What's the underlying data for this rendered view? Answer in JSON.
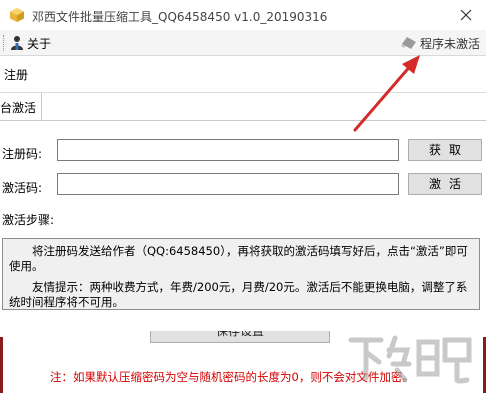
{
  "window": {
    "title": "邓西文件批量压缩工具_QQ6458450 v1.0_20190316",
    "close_icon": "close-icon",
    "app_icon": "app-box-icon"
  },
  "toolbar": {
    "about_label": "关于",
    "about_icon": "user-icon",
    "status_label": "程序未激活",
    "status_icon": "eraser-icon"
  },
  "outer_tabs": [
    {
      "label": "注册"
    }
  ],
  "inner_tabs": [
    {
      "label": "台激活"
    }
  ],
  "form": {
    "register_code_label": "注册码:",
    "register_code_value": "",
    "get_button": "获取",
    "activation_code_label": "激活码:",
    "activation_code_value": "",
    "activate_button": "激活",
    "steps_label": "激活步骤:"
  },
  "steps": {
    "line1": "将注册码发送给作者（QQ:6458450），再将获取的激活码填写好后，点击“激活”即可使用。",
    "line2": "友情提示：两种收费方式，年费/200元，月费/20元。激活后不能更换电脑，调整了系统时间程序将不可用。"
  },
  "bottom": {
    "save_button": "保存设置",
    "note": "注：如果默认压缩密码为空与随机密码的长度为0，则不会对文件加密。"
  },
  "colors": {
    "note_red": "#d40000",
    "arrow_red": "#d42a2a",
    "border_dark_red": "#8b1c1c"
  },
  "watermark": {
    "text": "下载吧"
  }
}
